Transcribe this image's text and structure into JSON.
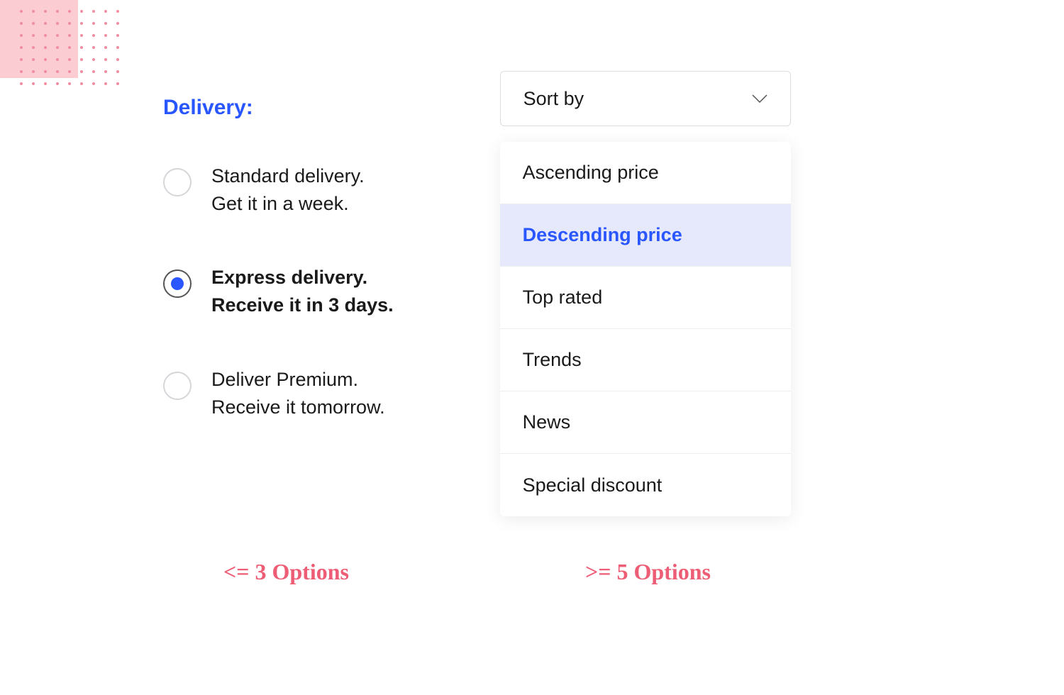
{
  "left": {
    "heading": "Delivery:",
    "options": [
      {
        "line1": "Standard delivery.",
        "line2": "Get it in a week.",
        "selected": false
      },
      {
        "line1": "Express delivery.",
        "line2": "Receive it in 3 days.",
        "selected": true
      },
      {
        "line1": "Deliver Premium.",
        "line2": "Receive it tomorrow.",
        "selected": false
      }
    ],
    "caption": "<= 3 Options"
  },
  "right": {
    "trigger_label": "Sort by",
    "options": [
      {
        "label": "Ascending price",
        "selected": false
      },
      {
        "label": "Descending price",
        "selected": true
      },
      {
        "label": "Top rated",
        "selected": false
      },
      {
        "label": "Trends",
        "selected": false
      },
      {
        "label": "News",
        "selected": false
      },
      {
        "label": "Special discount",
        "selected": false
      }
    ],
    "caption": ">= 5 Options"
  },
  "colors": {
    "accent": "#2956ff",
    "pink": "#ed5e76",
    "pink_light": "#fbcdd3",
    "highlight_bg": "#e6e9fb"
  }
}
